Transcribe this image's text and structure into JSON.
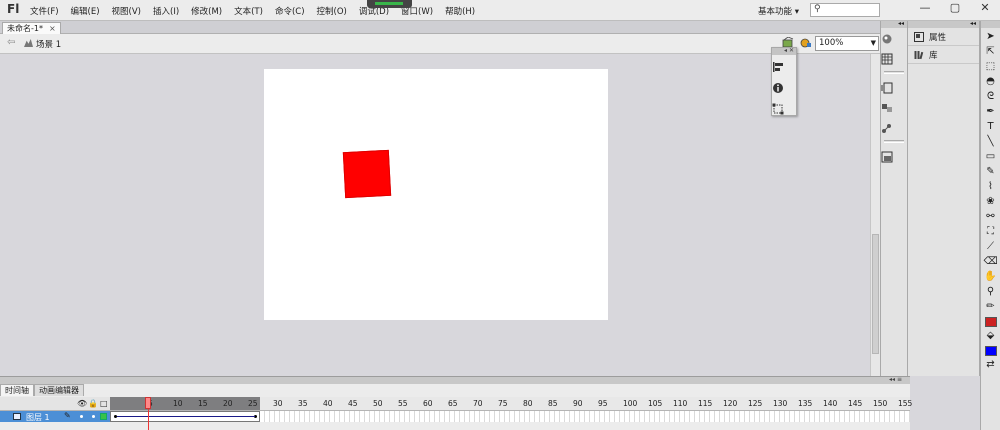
{
  "app": {
    "logo": "Fl",
    "menus": [
      "文件(F)",
      "编辑(E)",
      "视图(V)",
      "插入(I)",
      "修改(M)",
      "文本(T)",
      "命令(C)",
      "控制(O)",
      "调试(D)",
      "窗口(W)",
      "帮助(H)"
    ],
    "workspace": "基本功能 ▾",
    "search_placeholder": "",
    "window_controls": [
      "—",
      "▢",
      "✕"
    ]
  },
  "document": {
    "tab_title": "未命名-1*",
    "tab_close": "×",
    "scene_label": "场景 1",
    "zoom": "100%"
  },
  "panels": {
    "grip_label": "◂◂",
    "items": [
      {
        "label": "属性"
      },
      {
        "label": "库"
      }
    ]
  },
  "stage": {
    "background": "#ffffff",
    "shape_color": "#ff0000"
  },
  "timeline": {
    "tabs": [
      "时间轴",
      "动画编辑器"
    ],
    "layer_name": "图层 1",
    "ruler_numbers": [
      "5",
      "10",
      "15",
      "20",
      "25",
      "30",
      "35",
      "40",
      "45",
      "50",
      "55",
      "60",
      "65",
      "70",
      "75",
      "80",
      "85",
      "90",
      "95",
      "100",
      "105",
      "110",
      "115",
      "120",
      "125",
      "130",
      "135",
      "140",
      "145",
      "150",
      "155"
    ],
    "current_frame": 8
  },
  "tools": {
    "fill_color": "#cc2222",
    "stroke_color": "#0000ff"
  }
}
